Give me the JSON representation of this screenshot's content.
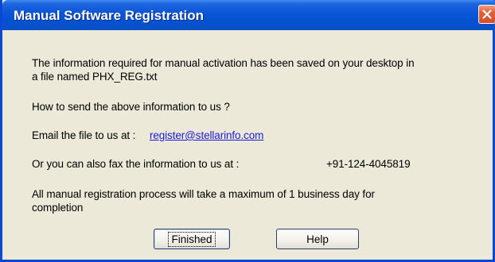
{
  "window": {
    "title": "Manual Software Registration"
  },
  "icons": {
    "close": "close-icon"
  },
  "content": {
    "info_line1": "The information required for manual activation has been saved on your desktop in",
    "info_line2": "a file named PHX_REG.txt",
    "send_question": "How to send the above information to us ?",
    "email_prefix": "Email the file  to us at  :",
    "email_address": "register@stellarinfo.com",
    "fax_prefix": "Or you can also fax the information  to us at  :",
    "fax_number": "+91-124-4045819",
    "process_line1": "All manual registration process will take a maximum of 1 business day for",
    "process_line2": "completion"
  },
  "buttons": {
    "finished": "Finished",
    "help": "Help"
  },
  "colors": {
    "titlebar": "#0a55d6",
    "close_button": "#e0603a",
    "dialog_background": "#ece9d8",
    "link": "#1a1ae0"
  }
}
